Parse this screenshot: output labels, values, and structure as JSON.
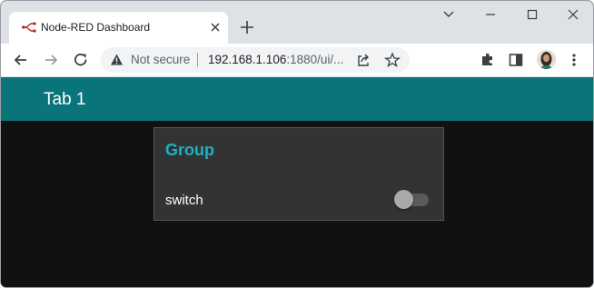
{
  "browser": {
    "tab": {
      "title": "Node-RED Dashboard",
      "close_icon": "close-icon",
      "favicon": "node-red-icon"
    },
    "new_tab_icon": "plus-icon",
    "window_controls": [
      "minimize-icon",
      "maximize-icon",
      "close-icon"
    ],
    "toolbar": {
      "back_icon": "back-arrow-icon",
      "forward_icon": "forward-arrow-icon",
      "reload_icon": "reload-icon",
      "security_label": "Not secure",
      "url_host": "192.168.1.106",
      "url_rest": ":1880/ui/...",
      "share_icon": "share-icon",
      "bookmark_icon": "star-icon",
      "extensions_icon": "puzzle-icon",
      "sidepanel_icon": "side-panel-icon",
      "menu_icon": "kebab-menu-icon"
    }
  },
  "dashboard": {
    "header_title": "Tab 1",
    "accent_color": "#097479",
    "group": {
      "title": "Group",
      "title_color": "#1bb3bf",
      "widgets": [
        {
          "type": "switch",
          "label": "switch",
          "state": "off"
        }
      ]
    }
  }
}
